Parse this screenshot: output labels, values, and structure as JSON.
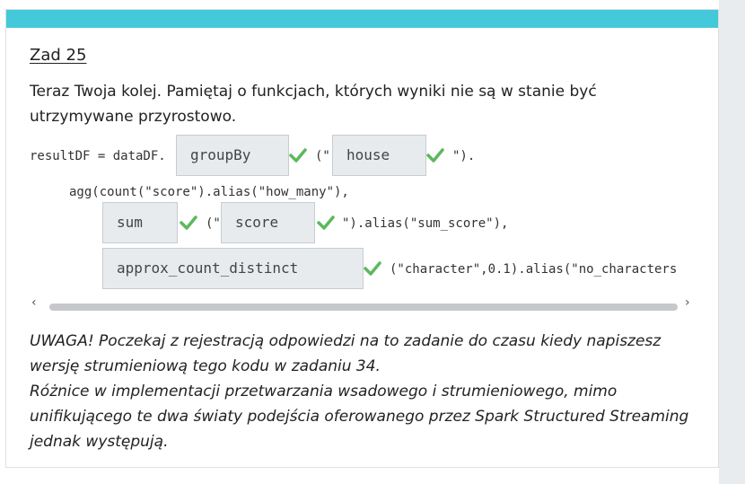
{
  "task": {
    "title": "Zad 25",
    "intro": "Teraz Twoja kolej. Pamiętaj o funkcjach, których wyniki nie są w stanie być utrzymywane przyrostowo."
  },
  "code": {
    "line1_prefix": "resultDF = dataDF.",
    "answer1": "groupBy",
    "line1_mid": "(\"",
    "answer2": "house",
    "line1_suffix": "\").",
    "line2": "agg(count(\"score\").alias(\"how_many\"),",
    "answer3": "sum",
    "line3_mid": "(\"",
    "answer4": "score",
    "line3_suffix": "\").alias(\"sum_score\"),",
    "answer5": "approx_count_distinct",
    "line4_suffix": "(\"character\",0.1).alias(\"no_characters"
  },
  "scrollbar": {
    "left_arrow": "‹",
    "right_arrow": "›"
  },
  "note": {
    "line1": "UWAGA! Poczekaj z rejestracją odpowiedzi na to zadanie do czasu kiedy napiszesz wersję strumieniową tego kodu w zadaniu 34.",
    "line2": "Różnice w implementacji przetwarzania wsadowego i strumieniowego, mimo unifikującego te dwa światy podejścia oferowanego przez Spark Structured Streaming jednak występują."
  },
  "colors": {
    "accent": "#43c9d9",
    "check": "#5cb85c"
  }
}
